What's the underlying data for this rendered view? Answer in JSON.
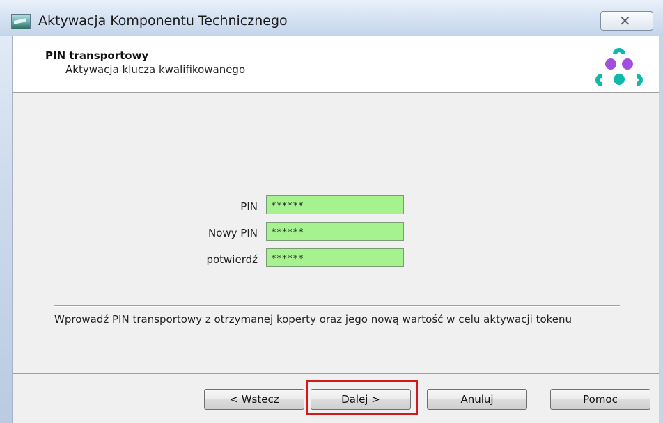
{
  "window": {
    "title": "Aktywacja Komponentu Technicznego",
    "close_label": "✕"
  },
  "header": {
    "title": "PIN transportowy",
    "subtitle": "Aktywacja klucza kwalifikowanego"
  },
  "form": {
    "pin": {
      "label": "PIN",
      "value": "******"
    },
    "new_pin": {
      "label": "Nowy PIN",
      "value": "******"
    },
    "confirm": {
      "label": "potwierdź",
      "value": "******"
    },
    "field_color": "#a5f28f"
  },
  "info": {
    "text": "Wprowadź PIN transportowy z otrzymanej koperty oraz jego nową wartość w celu aktywacji tokenu"
  },
  "buttons": {
    "back": "< Wstecz",
    "next": "Dalej >",
    "cancel": "Anuluj",
    "help": "Pomoc"
  },
  "colors": {
    "highlight": "#d21a1a",
    "logo_cyan": "#0fb8a8",
    "logo_purple": "#a24ee0"
  }
}
